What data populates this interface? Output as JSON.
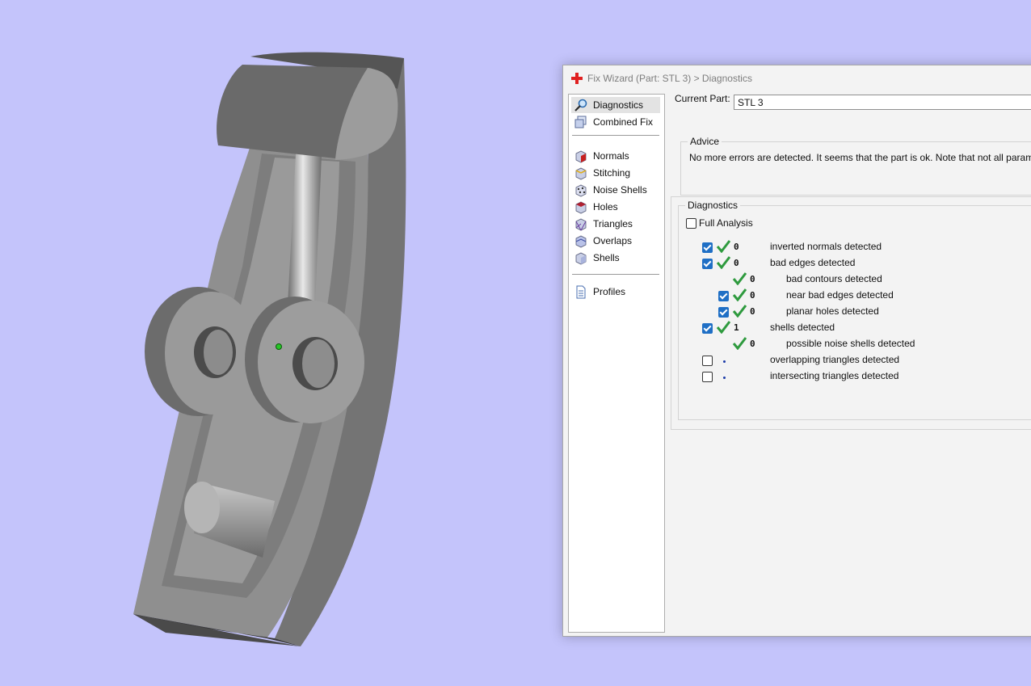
{
  "window": {
    "title": "Fix Wizard (Part: STL 3) > Diagnostics"
  },
  "nav": {
    "items": [
      {
        "label": "Diagnostics",
        "icon": "magnifier-icon",
        "selected": true
      },
      {
        "label": "Combined Fix",
        "icon": "combined-fix-icon"
      },
      {
        "label": "Normals",
        "icon": "normals-cube-icon"
      },
      {
        "label": "Stitching",
        "icon": "stitching-cube-icon"
      },
      {
        "label": "Noise Shells",
        "icon": "noise-shells-cube-icon"
      },
      {
        "label": "Holes",
        "icon": "holes-cube-icon"
      },
      {
        "label": "Triangles",
        "icon": "triangles-cube-icon"
      },
      {
        "label": "Overlaps",
        "icon": "overlaps-cube-icon"
      },
      {
        "label": "Shells",
        "icon": "shells-cube-icon"
      },
      {
        "label": "Profiles",
        "icon": "profiles-document-icon"
      }
    ]
  },
  "current_part": {
    "label": "Current Part:",
    "value": "STL 3"
  },
  "advice": {
    "title": "Advice",
    "text": "No more errors are detected. It seems that the part is ok. Note that not all parameters w"
  },
  "diagnostics": {
    "title": "Diagnostics",
    "full_analysis_label": "Full Analysis",
    "full_analysis_checked": false,
    "rows": [
      {
        "checkbox": true,
        "checked": true,
        "status": "ok",
        "count": "0",
        "label": "inverted normals detected"
      },
      {
        "checkbox": true,
        "checked": true,
        "status": "ok",
        "count": "0",
        "label": "bad edges detected"
      },
      {
        "checkbox": false,
        "status": "ok",
        "count": "0",
        "label": "bad contours detected"
      },
      {
        "checkbox": true,
        "checked": true,
        "status": "ok",
        "count": "0",
        "label": "near bad edges detected"
      },
      {
        "checkbox": true,
        "checked": true,
        "status": "ok",
        "count": "0",
        "label": "planar holes detected"
      },
      {
        "checkbox": true,
        "checked": true,
        "status": "ok",
        "count": "1",
        "label": "shells detected"
      },
      {
        "checkbox": false,
        "status": "ok",
        "count": "0",
        "label": "possible noise shells detected"
      },
      {
        "checkbox": true,
        "checked": false,
        "status": "pending",
        "count": "",
        "label": "overlapping triangles detected"
      },
      {
        "checkbox": true,
        "checked": false,
        "status": "pending",
        "count": "",
        "label": "intersecting triangles detected"
      }
    ]
  },
  "colors": {
    "viewport_background": "#c4c4fb",
    "model_gray": "#8a8a8a",
    "check_blue": "#1f6fc5",
    "ok_green": "#2e9a3e"
  }
}
